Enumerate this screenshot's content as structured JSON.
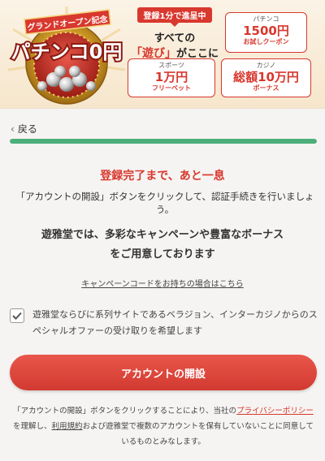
{
  "banner": {
    "logo": {
      "ribbon_text": "グランドオープン記念",
      "brand_text": "パチンコ0円",
      "colors": {
        "ribbon": "#d8382e",
        "gold": "#e8b331",
        "disk": "#c8291f"
      }
    },
    "headline": {
      "pill": "登録1分で進呈中",
      "line1": "すべての",
      "line2_em": "「遊び」",
      "line2_rest": "がここに"
    },
    "promos": [
      {
        "title": "パチンコ",
        "value": "1500円",
        "sub": "お試しクーポン"
      },
      {
        "title": "スポーツ",
        "value": "1万円",
        "sub": "フリーベット"
      },
      {
        "title": "カジノ",
        "value": "総額10万円",
        "sub": "ボーナス"
      }
    ]
  },
  "nav": {
    "back_icon": "chevron-left-icon",
    "back_label": "戻る"
  },
  "progress": {
    "value": 1.0,
    "color": "#4caf7a"
  },
  "main": {
    "title": "登録完了まで、あと一息",
    "instruction": "「アカウントの開設」ボタンをクリックして、認証手続きを行いましょう。",
    "lead": "遊雅堂では、多彩なキャンペーンや豊富なボーナスをご用意しております",
    "campaign_link": "キャンペーンコードをお持ちの場合はこちら",
    "consent": {
      "checked": true,
      "text": "遊雅堂ならびに系列サイトであるベラジョン、インターカジノからのスペシャルオファーの受け取りを希望します"
    },
    "cta_label": "アカウントの開設",
    "terms": {
      "part1": "「アカウントの開設」ボタンをクリックすることにより、当社の",
      "privacy_link": "プライバシーポリシー",
      "part2": "を理解し、",
      "terms_link": "利用規約",
      "part3": "および遊雅堂で複数のアカウントを保有していないことに同意しているものとみなします。"
    }
  },
  "colors": {
    "accent": "#d8382e",
    "progress": "#4caf7a",
    "background": "#f6f4f2"
  }
}
